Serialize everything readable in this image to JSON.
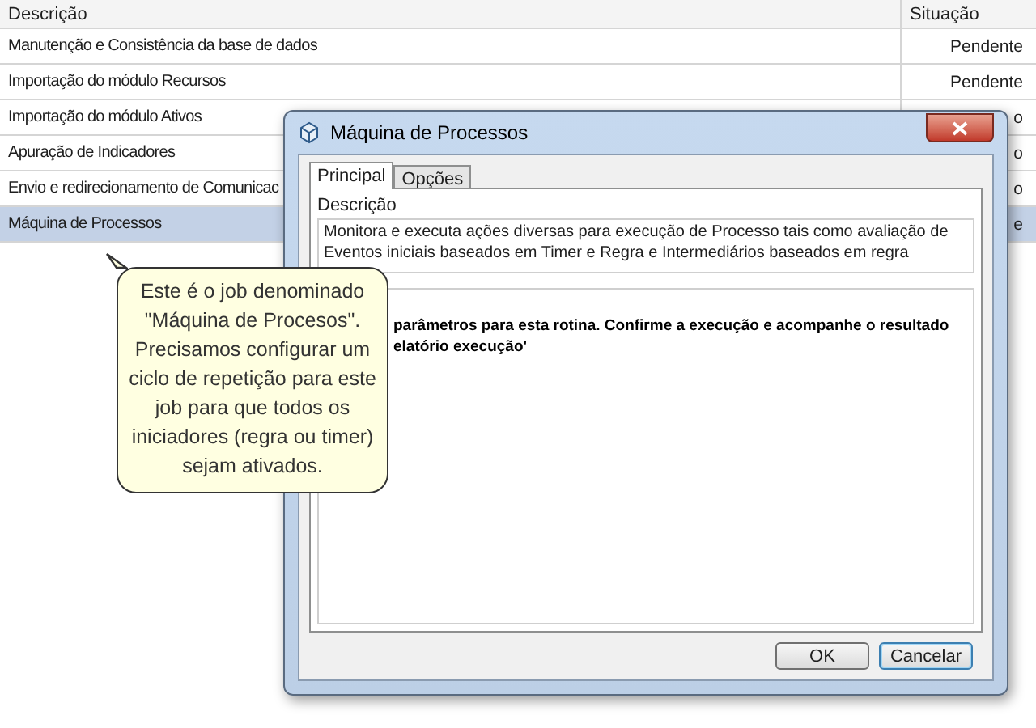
{
  "table": {
    "columns": [
      "Descrição",
      "Situação"
    ],
    "rows": [
      {
        "description": "Manutenção e Consistência da base de dados",
        "status": "Pendente",
        "selected": false
      },
      {
        "description": "Importação do módulo Recursos",
        "status": "Pendente",
        "selected": false
      },
      {
        "description": "Importação do módulo Ativos",
        "status": "o",
        "selected": false
      },
      {
        "description": "Apuração de Indicadores",
        "status": "o",
        "selected": false
      },
      {
        "description": "Envio e redirecionamento de Comunicac",
        "status": "o",
        "selected": false
      },
      {
        "description": "Máquina de Processos",
        "status": "e",
        "selected": true
      }
    ]
  },
  "dialog": {
    "title": "Máquina de Processos",
    "tabs": [
      {
        "label": "Principal",
        "selected": true
      },
      {
        "label": "Opções",
        "selected": false
      }
    ],
    "description_label": "Descrição",
    "description_value": "Monitora e executa ações diversas para execução de Processo tais como avaliação de Eventos iniciais baseados em Timer e Regra e Intermediários baseados em regra",
    "message_lines": [
      "parâmetros para esta rotina. Confirme a execução e acompanhe o resultado",
      "elatório execução'"
    ],
    "buttons": [
      {
        "label": "OK",
        "focused": false
      },
      {
        "label": "Cancelar",
        "focused": true
      }
    ]
  },
  "callout": {
    "text": "Este é o job denominado \"Máquina de Procesos\". Precisamos configurar um ciclo de repetição para este job para que todos os iniciadores (regra ou timer) sejam ativados."
  }
}
